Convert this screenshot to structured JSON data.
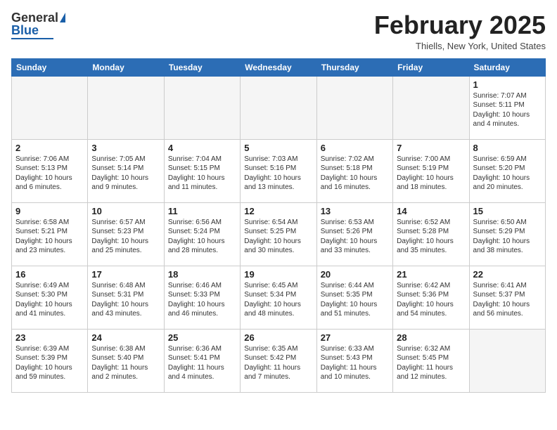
{
  "header": {
    "logo_general": "General",
    "logo_blue": "Blue",
    "month_title": "February 2025",
    "location": "Thiells, New York, United States"
  },
  "weekdays": [
    "Sunday",
    "Monday",
    "Tuesday",
    "Wednesday",
    "Thursday",
    "Friday",
    "Saturday"
  ],
  "weeks": [
    [
      {
        "day": "",
        "info": ""
      },
      {
        "day": "",
        "info": ""
      },
      {
        "day": "",
        "info": ""
      },
      {
        "day": "",
        "info": ""
      },
      {
        "day": "",
        "info": ""
      },
      {
        "day": "",
        "info": ""
      },
      {
        "day": "1",
        "info": "Sunrise: 7:07 AM\nSunset: 5:11 PM\nDaylight: 10 hours and 4 minutes."
      }
    ],
    [
      {
        "day": "2",
        "info": "Sunrise: 7:06 AM\nSunset: 5:13 PM\nDaylight: 10 hours and 6 minutes."
      },
      {
        "day": "3",
        "info": "Sunrise: 7:05 AM\nSunset: 5:14 PM\nDaylight: 10 hours and 9 minutes."
      },
      {
        "day": "4",
        "info": "Sunrise: 7:04 AM\nSunset: 5:15 PM\nDaylight: 10 hours and 11 minutes."
      },
      {
        "day": "5",
        "info": "Sunrise: 7:03 AM\nSunset: 5:16 PM\nDaylight: 10 hours and 13 minutes."
      },
      {
        "day": "6",
        "info": "Sunrise: 7:02 AM\nSunset: 5:18 PM\nDaylight: 10 hours and 16 minutes."
      },
      {
        "day": "7",
        "info": "Sunrise: 7:00 AM\nSunset: 5:19 PM\nDaylight: 10 hours and 18 minutes."
      },
      {
        "day": "8",
        "info": "Sunrise: 6:59 AM\nSunset: 5:20 PM\nDaylight: 10 hours and 20 minutes."
      }
    ],
    [
      {
        "day": "9",
        "info": "Sunrise: 6:58 AM\nSunset: 5:21 PM\nDaylight: 10 hours and 23 minutes."
      },
      {
        "day": "10",
        "info": "Sunrise: 6:57 AM\nSunset: 5:23 PM\nDaylight: 10 hours and 25 minutes."
      },
      {
        "day": "11",
        "info": "Sunrise: 6:56 AM\nSunset: 5:24 PM\nDaylight: 10 hours and 28 minutes."
      },
      {
        "day": "12",
        "info": "Sunrise: 6:54 AM\nSunset: 5:25 PM\nDaylight: 10 hours and 30 minutes."
      },
      {
        "day": "13",
        "info": "Sunrise: 6:53 AM\nSunset: 5:26 PM\nDaylight: 10 hours and 33 minutes."
      },
      {
        "day": "14",
        "info": "Sunrise: 6:52 AM\nSunset: 5:28 PM\nDaylight: 10 hours and 35 minutes."
      },
      {
        "day": "15",
        "info": "Sunrise: 6:50 AM\nSunset: 5:29 PM\nDaylight: 10 hours and 38 minutes."
      }
    ],
    [
      {
        "day": "16",
        "info": "Sunrise: 6:49 AM\nSunset: 5:30 PM\nDaylight: 10 hours and 41 minutes."
      },
      {
        "day": "17",
        "info": "Sunrise: 6:48 AM\nSunset: 5:31 PM\nDaylight: 10 hours and 43 minutes."
      },
      {
        "day": "18",
        "info": "Sunrise: 6:46 AM\nSunset: 5:33 PM\nDaylight: 10 hours and 46 minutes."
      },
      {
        "day": "19",
        "info": "Sunrise: 6:45 AM\nSunset: 5:34 PM\nDaylight: 10 hours and 48 minutes."
      },
      {
        "day": "20",
        "info": "Sunrise: 6:44 AM\nSunset: 5:35 PM\nDaylight: 10 hours and 51 minutes."
      },
      {
        "day": "21",
        "info": "Sunrise: 6:42 AM\nSunset: 5:36 PM\nDaylight: 10 hours and 54 minutes."
      },
      {
        "day": "22",
        "info": "Sunrise: 6:41 AM\nSunset: 5:37 PM\nDaylight: 10 hours and 56 minutes."
      }
    ],
    [
      {
        "day": "23",
        "info": "Sunrise: 6:39 AM\nSunset: 5:39 PM\nDaylight: 10 hours and 59 minutes."
      },
      {
        "day": "24",
        "info": "Sunrise: 6:38 AM\nSunset: 5:40 PM\nDaylight: 11 hours and 2 minutes."
      },
      {
        "day": "25",
        "info": "Sunrise: 6:36 AM\nSunset: 5:41 PM\nDaylight: 11 hours and 4 minutes."
      },
      {
        "day": "26",
        "info": "Sunrise: 6:35 AM\nSunset: 5:42 PM\nDaylight: 11 hours and 7 minutes."
      },
      {
        "day": "27",
        "info": "Sunrise: 6:33 AM\nSunset: 5:43 PM\nDaylight: 11 hours and 10 minutes."
      },
      {
        "day": "28",
        "info": "Sunrise: 6:32 AM\nSunset: 5:45 PM\nDaylight: 11 hours and 12 minutes."
      },
      {
        "day": "",
        "info": ""
      }
    ]
  ]
}
